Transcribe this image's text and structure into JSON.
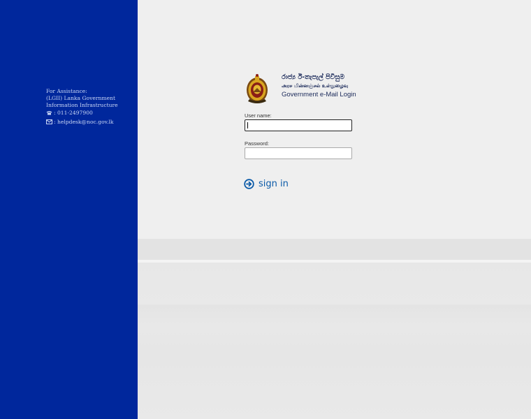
{
  "colors": {
    "sidebar": "#00279c",
    "background": "#eeeeee",
    "accent": "#0a5aa8"
  },
  "assistance": {
    "heading": "For Assistance:",
    "org": "(LGII) Lanka Government Information Infrastructure",
    "phone": ": 011-2497900",
    "email": ": helpdesk@noc.gov.lk",
    "phone_icon": "phone-icon",
    "email_icon": "mail-icon"
  },
  "logo": {
    "sinhala": "රාජ්‍ය ඊ-තැපැල් පිවිසුම",
    "tamil": "அரச மின்னஞ்சல் உள்நுழைவு",
    "english": "Government e-Mail Login",
    "icon": "government-emblem"
  },
  "form": {
    "username_label": "User name:",
    "username_value": "",
    "password_label": "Password:",
    "password_value": "",
    "signin_label": "sign in",
    "signin_icon": "arrow-circle-right-icon"
  }
}
